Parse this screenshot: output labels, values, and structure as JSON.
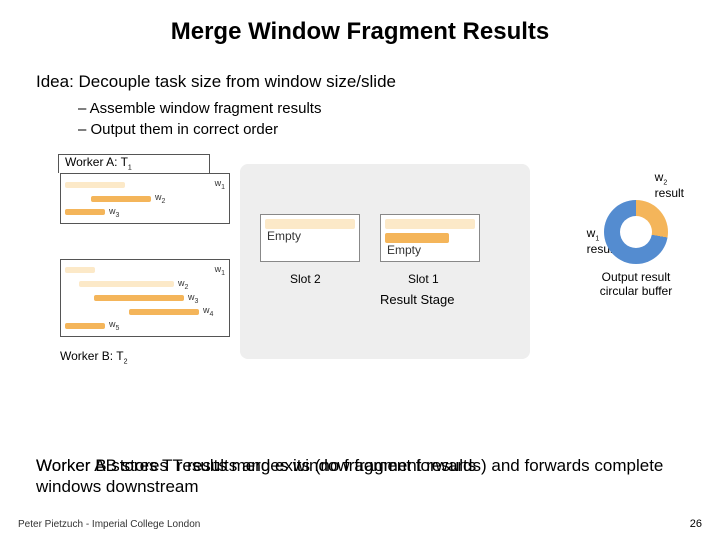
{
  "title": "Merge Window Fragment Results",
  "idea": "Idea: Decouple task size from window size/slide",
  "bullets": {
    "b1": "– Assemble window fragment results",
    "b2": "– Output them in correct order"
  },
  "workerA": {
    "label": "Worker A: T",
    "sub": "1",
    "w1": "w",
    "w1s": "1",
    "w2": "w",
    "w2s": "2",
    "w3": "w",
    "w3s": "3"
  },
  "workerB": {
    "label": "Worker B: T",
    "sub": "2",
    "w1": "w",
    "w1s": "1",
    "w2": "w",
    "w2s": "2",
    "w3": "w",
    "w3s": "3",
    "w4": "w",
    "w4s": "4",
    "w5": "w",
    "w5s": "5"
  },
  "slots": {
    "empty": "Empty",
    "slot2": "Slot 2",
    "slot1": "Slot 1",
    "stage": "Result Stage"
  },
  "right": {
    "w2": "w",
    "w2s": "2",
    "w2res": "result",
    "w1": "w",
    "w1s": "1",
    "w1res": "result",
    "donut": "Output result circular buffer"
  },
  "bottom": {
    "line": "Worker AB stores T  results and exits (no fragment forwards) and forwards complete windows downstream",
    "overlay": "Worker B stores T  results merges window fragment results"
  },
  "footer": "Peter Pietzuch - Imperial College London",
  "pagenum": "26",
  "chart_data": {
    "type": "diagram",
    "description": "Two worker tasks (A:T1, B:T2) each produce window fragment bars (w1..w5). Fragments flow into a Result Stage with Slot 1 and Slot 2 (currently Empty). An output-result circular buffer (donut) shows w1 result (blue, majority) and w2 result (orange).",
    "workers": [
      {
        "name": "Worker A",
        "task": "T1",
        "fragments": [
          "w1",
          "w2",
          "w3"
        ]
      },
      {
        "name": "Worker B",
        "task": "T2",
        "fragments": [
          "w1",
          "w2",
          "w3",
          "w4",
          "w5"
        ]
      }
    ],
    "result_stage_slots": [
      "Slot 1",
      "Slot 2"
    ],
    "circular_buffer": [
      {
        "label": "w1 result",
        "color": "#548cd0",
        "approx_fraction": 0.72
      },
      {
        "label": "w2 result",
        "color": "#f4b55a",
        "approx_fraction": 0.28
      }
    ]
  }
}
